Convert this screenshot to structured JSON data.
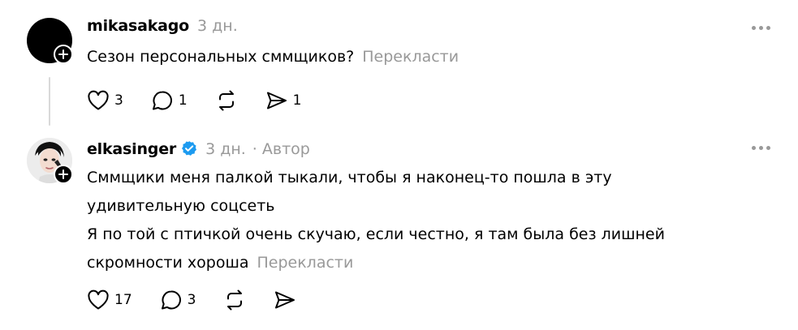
{
  "posts": [
    {
      "username": "mikasakago",
      "time": "3 дн.",
      "author_tag": "",
      "text_lines": [
        "Сезон персональных сммщиков?"
      ],
      "translate_label": "Перекласти",
      "likes": "3",
      "replies": "1",
      "reposts": "",
      "shares": "1",
      "verified": false
    },
    {
      "username": "elkasinger",
      "time": "3 дн.",
      "author_tag": "· Автор",
      "text_lines": [
        "Сммщики меня палкой тыкали, чтобы я наконец-то пошла в эту",
        "удивительную соцсеть",
        "Я по той с птичкой очень скучаю, если честно, я там была без лишней",
        "скромности хороша"
      ],
      "translate_label": "Перекласти",
      "likes": "17",
      "replies": "3",
      "reposts": "",
      "shares": "",
      "verified": true
    }
  ],
  "icons": {
    "like": "heart-icon",
    "reply": "comment-icon",
    "repost": "repost-icon",
    "share": "send-icon",
    "more": "more-icon",
    "verified": "verified-badge-icon",
    "follow": "plus-icon"
  },
  "colors": {
    "text": "#000000",
    "muted": "#999999",
    "verified": "#1d9bf0",
    "thread_line": "#d9d9d9"
  }
}
